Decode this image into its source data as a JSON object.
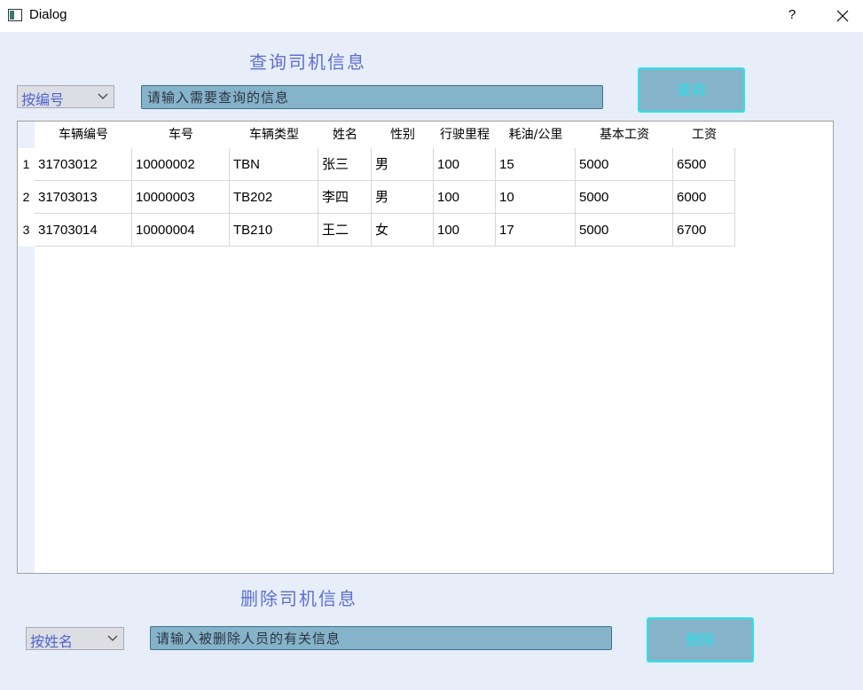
{
  "window": {
    "title": "Dialog",
    "help_label": "?"
  },
  "query": {
    "title": "查询司机信息",
    "combo_value": "按编号",
    "input_placeholder": "请输入需要查询的信息",
    "button_label": "查询"
  },
  "table": {
    "headers": [
      "车辆编号",
      "车号",
      "车辆类型",
      "姓名",
      "性别",
      "行驶里程",
      "耗油/公里",
      "基本工资",
      "工资"
    ],
    "rows": [
      {
        "num": "1",
        "cells": [
          "31703012",
          "10000002",
          "TBN",
          "张三",
          "男",
          "100",
          "15",
          "5000",
          "6500"
        ]
      },
      {
        "num": "2",
        "cells": [
          "31703013",
          "10000003",
          "TB202",
          "李四",
          "男",
          "100",
          "10",
          "5000",
          "6000"
        ]
      },
      {
        "num": "3",
        "cells": [
          "31703014",
          "10000004",
          "TB210",
          "王二",
          "女",
          "100",
          "17",
          "5000",
          "6700"
        ]
      }
    ]
  },
  "delete": {
    "title": "删除司机信息",
    "combo_value": "按姓名",
    "input_placeholder": "请输入被删除人员的有关信息",
    "button_label": "删除"
  },
  "colors": {
    "background": "#e7eef9",
    "accent_title": "#5f6fd0",
    "input_fill": "#85b3c9",
    "button_border": "#29e4ea"
  }
}
